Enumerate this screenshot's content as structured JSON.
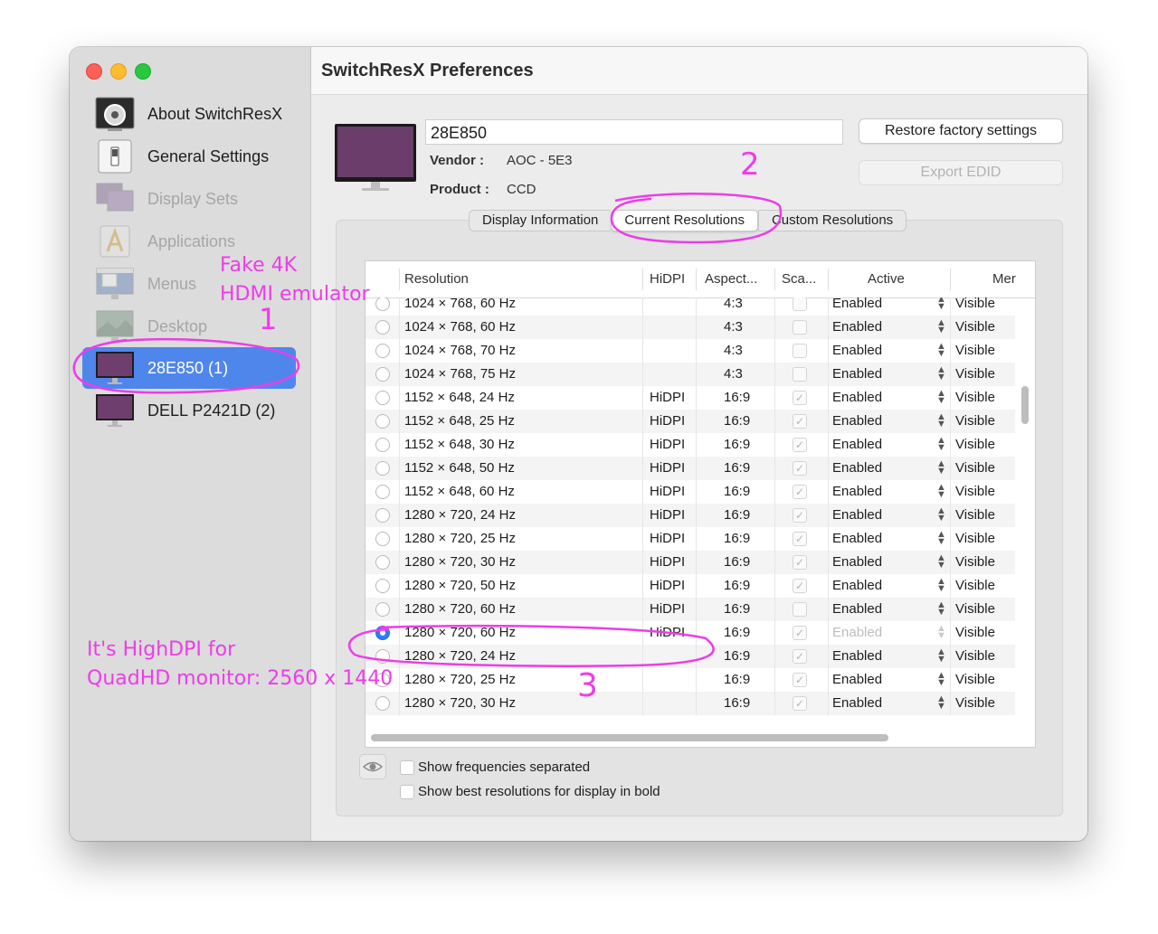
{
  "window": {
    "title": "SwitchResX Preferences"
  },
  "sidebar": {
    "items": [
      {
        "label": "About SwitchResX",
        "icon": "about-icon",
        "state": "normal"
      },
      {
        "label": "General Settings",
        "icon": "switch-icon",
        "state": "normal"
      },
      {
        "label": "Display Sets",
        "icon": "display-sets-icon",
        "state": "disabled"
      },
      {
        "label": "Applications",
        "icon": "applications-icon",
        "state": "disabled"
      },
      {
        "label": "Menus",
        "icon": "menus-icon",
        "state": "disabled"
      },
      {
        "label": "Desktop",
        "icon": "desktop-icon",
        "state": "disabled"
      },
      {
        "label": "28E850 (1)",
        "icon": "monitor-icon",
        "state": "selected"
      },
      {
        "label": "DELL P2421D (2)",
        "icon": "monitor-icon",
        "state": "normal"
      }
    ]
  },
  "display": {
    "name": "28E850",
    "vendor_label": "Vendor :",
    "vendor": "AOC - 5E3",
    "product_label": "Product :",
    "product": "CCD"
  },
  "buttons": {
    "restore": "Restore factory settings",
    "export": "Export EDID"
  },
  "tabs": [
    {
      "label": "Display Information",
      "active": false
    },
    {
      "label": "Current Resolutions",
      "active": true
    },
    {
      "label": "Custom Resolutions",
      "active": false
    }
  ],
  "table": {
    "headers": {
      "resolution": "Resolution",
      "hidpi": "HiDPI",
      "aspect": "Aspect...",
      "scaled": "Sca...",
      "active": "Active",
      "menu": "Mer"
    },
    "rows": [
      {
        "resolution": "1024 × 768, 60 Hz",
        "hidpi": "",
        "aspect": "4:3",
        "checked": false,
        "active": "Enabled",
        "menu": "Visible",
        "selected": false,
        "muted": false
      },
      {
        "resolution": "1024 × 768, 60 Hz",
        "hidpi": "",
        "aspect": "4:3",
        "checked": false,
        "active": "Enabled",
        "menu": "Visible",
        "selected": false,
        "muted": false
      },
      {
        "resolution": "1024 × 768, 70 Hz",
        "hidpi": "",
        "aspect": "4:3",
        "checked": false,
        "active": "Enabled",
        "menu": "Visible",
        "selected": false,
        "muted": false
      },
      {
        "resolution": "1024 × 768, 75 Hz",
        "hidpi": "",
        "aspect": "4:3",
        "checked": false,
        "active": "Enabled",
        "menu": "Visible",
        "selected": false,
        "muted": false
      },
      {
        "resolution": "1152 × 648, 24 Hz",
        "hidpi": "HiDPI",
        "aspect": "16:9",
        "checked": true,
        "active": "Enabled",
        "menu": "Visible",
        "selected": false,
        "muted": false
      },
      {
        "resolution": "1152 × 648, 25 Hz",
        "hidpi": "HiDPI",
        "aspect": "16:9",
        "checked": true,
        "active": "Enabled",
        "menu": "Visible",
        "selected": false,
        "muted": false
      },
      {
        "resolution": "1152 × 648, 30 Hz",
        "hidpi": "HiDPI",
        "aspect": "16:9",
        "checked": true,
        "active": "Enabled",
        "menu": "Visible",
        "selected": false,
        "muted": false
      },
      {
        "resolution": "1152 × 648, 50 Hz",
        "hidpi": "HiDPI",
        "aspect": "16:9",
        "checked": true,
        "active": "Enabled",
        "menu": "Visible",
        "selected": false,
        "muted": false
      },
      {
        "resolution": "1152 × 648, 60 Hz",
        "hidpi": "HiDPI",
        "aspect": "16:9",
        "checked": true,
        "active": "Enabled",
        "menu": "Visible",
        "selected": false,
        "muted": false
      },
      {
        "resolution": "1280 × 720, 24 Hz",
        "hidpi": "HiDPI",
        "aspect": "16:9",
        "checked": true,
        "active": "Enabled",
        "menu": "Visible",
        "selected": false,
        "muted": false
      },
      {
        "resolution": "1280 × 720, 25 Hz",
        "hidpi": "HiDPI",
        "aspect": "16:9",
        "checked": true,
        "active": "Enabled",
        "menu": "Visible",
        "selected": false,
        "muted": false
      },
      {
        "resolution": "1280 × 720, 30 Hz",
        "hidpi": "HiDPI",
        "aspect": "16:9",
        "checked": true,
        "active": "Enabled",
        "menu": "Visible",
        "selected": false,
        "muted": false
      },
      {
        "resolution": "1280 × 720, 50 Hz",
        "hidpi": "HiDPI",
        "aspect": "16:9",
        "checked": true,
        "active": "Enabled",
        "menu": "Visible",
        "selected": false,
        "muted": false
      },
      {
        "resolution": "1280 × 720, 60 Hz",
        "hidpi": "HiDPI",
        "aspect": "16:9",
        "checked": false,
        "active": "Enabled",
        "menu": "Visible",
        "selected": false,
        "muted": false
      },
      {
        "resolution": "1280 × 720, 60 Hz",
        "hidpi": "HiDPI",
        "aspect": "16:9",
        "checked": true,
        "active": "Enabled",
        "menu": "Visible",
        "selected": true,
        "muted": true
      },
      {
        "resolution": "1280 × 720, 24 Hz",
        "hidpi": "",
        "aspect": "16:9",
        "checked": true,
        "active": "Enabled",
        "menu": "Visible",
        "selected": false,
        "muted": false
      },
      {
        "resolution": "1280 × 720, 25 Hz",
        "hidpi": "",
        "aspect": "16:9",
        "checked": true,
        "active": "Enabled",
        "menu": "Visible",
        "selected": false,
        "muted": false
      },
      {
        "resolution": "1280 × 720, 30 Hz",
        "hidpi": "",
        "aspect": "16:9",
        "checked": true,
        "active": "Enabled",
        "menu": "Visible",
        "selected": false,
        "muted": false
      }
    ]
  },
  "options": {
    "show_frequencies": "Show frequencies separated",
    "show_best": "Show best resolutions for display in bold"
  },
  "annotations": {
    "fake_line1": "Fake 4K",
    "fake_line2": "HDMI emulator",
    "num1": "1",
    "num2": "2",
    "num3": "3",
    "note_line1": "It's HighDPI for",
    "note_line2": "QuadHD monitor: 2560 x 1440",
    "color": "#ee3ce8"
  },
  "colors": {
    "selection": "#4f86ec",
    "radio_on": "#2f7cf6"
  }
}
